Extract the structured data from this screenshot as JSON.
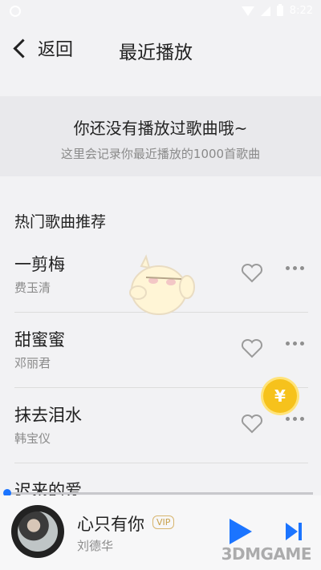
{
  "status_bar": {
    "time": "8:22"
  },
  "nav": {
    "back_label": "返回",
    "title": "最近播放"
  },
  "empty_state": {
    "title": "你还没有播放过歌曲哦~",
    "subtitle": "这里会记录你最近播放的1000首歌曲"
  },
  "recommend": {
    "title": "热门歌曲推荐",
    "songs": [
      {
        "name": "一剪梅",
        "artist": "费玉清"
      },
      {
        "name": "甜蜜蜜",
        "artist": "邓丽君"
      },
      {
        "name": "抹去泪水",
        "artist": "韩宝仪"
      },
      {
        "name": "迟来的爱",
        "artist": ""
      }
    ]
  },
  "player": {
    "song": "心只有你",
    "artist": "刘德华",
    "badge": "VIP",
    "progress": 0.0
  },
  "coin_symbol": "¥",
  "watermark": "3DMGAME",
  "icons": {
    "back": "chevron-left-icon",
    "heart": "heart-outline-icon",
    "more": "more-horizontal-icon",
    "play": "play-icon",
    "next": "skip-next-icon"
  },
  "colors": {
    "accent": "#1b74ff",
    "coin": "#f6c21c"
  }
}
